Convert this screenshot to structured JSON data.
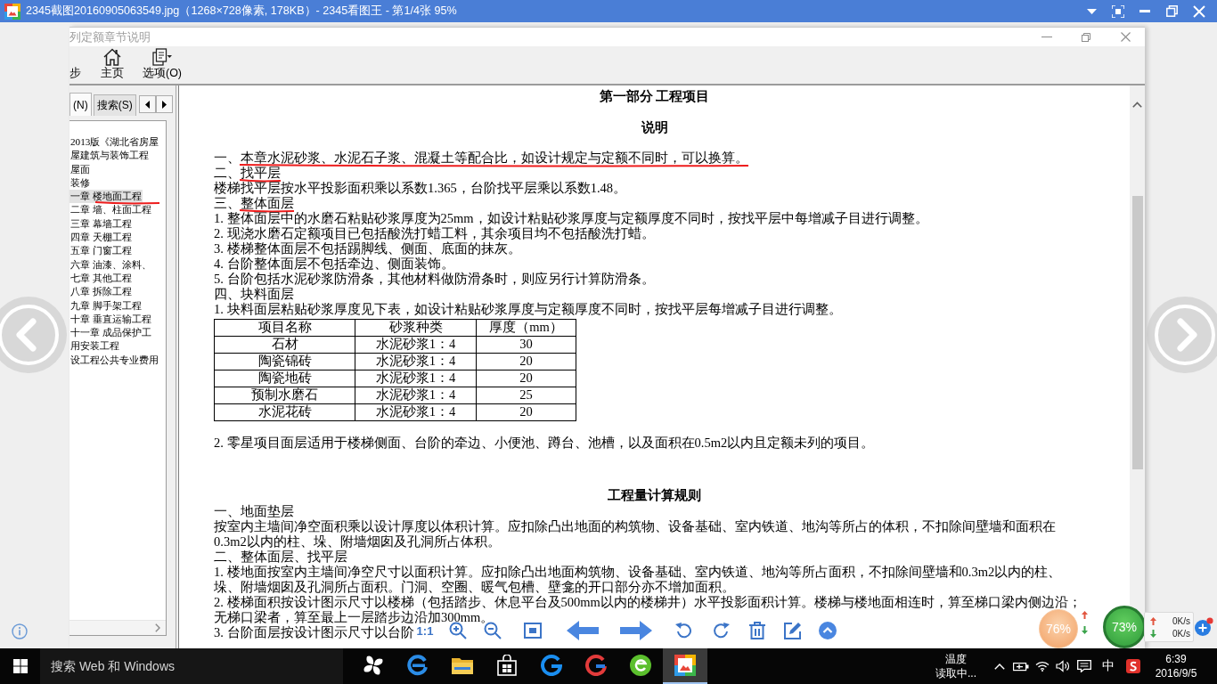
{
  "title_bar": {
    "title": "2345截图20160905063549.jpg（1268×728像素, 178KB）- 2345看图王 - 第1/4张 95%"
  },
  "document_window": {
    "title": "列定额章节说明",
    "toolbar": [
      {
        "kind": "plain",
        "label": "步"
      },
      {
        "kind": "home",
        "label": "主页"
      },
      {
        "kind": "options",
        "label": "选项(O)"
      }
    ]
  },
  "sidebar": {
    "tabs": [
      {
        "label": "(N)",
        "selected": true
      },
      {
        "label": "搜索(S)",
        "selected": false
      }
    ],
    "tree": [
      {
        "label": "2013版《湖北省房屋",
        "selected": false,
        "marked": false
      },
      {
        "label": "屋建筑与装饰工程",
        "selected": false,
        "marked": false
      },
      {
        "label": "屋面",
        "selected": false,
        "marked": false
      },
      {
        "label": "装修",
        "selected": false,
        "marked": false
      },
      {
        "label": "一章 楼地面工程",
        "selected": true,
        "marked": true
      },
      {
        "label": "二章 墙、柱面工程",
        "selected": false,
        "marked": false
      },
      {
        "label": "三章 幕墙工程",
        "selected": false,
        "marked": false
      },
      {
        "label": "四章 天棚工程",
        "selected": false,
        "marked": false
      },
      {
        "label": "五章 门窗工程",
        "selected": false,
        "marked": false
      },
      {
        "label": "六章 油漆、涂料、",
        "selected": false,
        "marked": false
      },
      {
        "label": "七章 其他工程",
        "selected": false,
        "marked": false
      },
      {
        "label": "八章 拆除工程",
        "selected": false,
        "marked": false
      },
      {
        "label": "九章 脚手架工程",
        "selected": false,
        "marked": false
      },
      {
        "label": "十章 垂直运输工程",
        "selected": false,
        "marked": false
      },
      {
        "label": "十一章 成品保护工",
        "selected": false,
        "marked": false
      },
      {
        "label": "用安装工程",
        "selected": false,
        "marked": false
      },
      {
        "label": "设工程公共专业费用",
        "selected": false,
        "marked": false
      }
    ]
  },
  "content": {
    "part_title": "第一部分 工程项目",
    "sections": [
      {
        "title": "说明",
        "blocks": [
          {
            "kind": "line",
            "text": "一、本章水泥砂浆、水泥石子浆、混凝土等配合比，如设计规定与定额不同时，可以换算。",
            "marked": true
          },
          {
            "kind": "line",
            "text": "二、找平层",
            "marked": true
          },
          {
            "kind": "line",
            "text": "楼梯找平层按水平投影面积乘以系数1.365，台阶找平层乘以系数1.48。",
            "marked": false
          },
          {
            "kind": "line",
            "text": "三、整体面层",
            "marked": true
          },
          {
            "kind": "line",
            "text": "1. 整体面层中的水磨石粘贴砂浆厚度为25mm，如设计粘贴砂浆厚度与定额厚度不同时，按找平层中每增减子目进行调整。",
            "marked": false
          },
          {
            "kind": "line",
            "text": "2. 现浇水磨石定额项目已包括酸洗打蜡工料，其余项目均不包括酸洗打蜡。",
            "marked": false
          },
          {
            "kind": "line",
            "text": "3. 楼梯整体面层不包括踢脚线、侧面、底面的抹灰。",
            "marked": false
          },
          {
            "kind": "line",
            "text": "4. 台阶整体面层不包括牵边、侧面装饰。",
            "marked": false
          },
          {
            "kind": "line",
            "text": "5. 台阶包括水泥砂浆防滑条，其他材料做防滑条时，则应另行计算防滑条。",
            "marked": false
          },
          {
            "kind": "line",
            "text": "四、块料面层",
            "marked": false
          },
          {
            "kind": "line",
            "text": "1. 块料面层粘贴砂浆厚度见下表，如设计粘贴砂浆厚度与定额厚度不同时，按找平层每增减子目进行调整。",
            "marked": false
          },
          {
            "kind": "table",
            "columns": [
              "项目名称",
              "砂浆种类",
              "厚度（mm）"
            ],
            "rows": [
              [
                "石材",
                "水泥砂浆1：4",
                "30"
              ],
              [
                "陶瓷锦砖",
                "水泥砂浆1：4",
                "20"
              ],
              [
                "陶瓷地砖",
                "水泥砂浆1：4",
                "20"
              ],
              [
                "预制水磨石",
                "水泥砂浆1：4",
                "25"
              ],
              [
                "水泥花砖",
                "水泥砂浆1：4",
                "20"
              ]
            ]
          },
          {
            "kind": "line",
            "text": "2. 零星项目面层适用于楼梯侧面、台阶的牵边、小便池、蹲台、池槽，以及面积在0.5m2以内且定额未列的项目。",
            "marked": false
          }
        ]
      },
      {
        "title": "工程量计算规则",
        "blocks": [
          {
            "kind": "line",
            "text": "一、地面垫层",
            "marked": false
          },
          {
            "kind": "line",
            "text": "按室内主墙间净空面积乘以设计厚度以体积计算。应扣除凸出地面的构筑物、设备基础、室内铁道、地沟等所占的体积，不扣除间壁墙和面积在",
            "marked": false
          },
          {
            "kind": "line",
            "text": "0.3m2以内的柱、垛、附墙烟囱及孔洞所占体积。",
            "marked": false
          },
          {
            "kind": "line",
            "text": "二、整体面层、找平层",
            "marked": false
          },
          {
            "kind": "line",
            "text": "1. 楼地面按室内主墙间净空尺寸以面积计算。应扣除凸出地面构筑物、设备基础、室内铁道、地沟等所占面积，不扣除间壁墙和0.3m2以内的柱、",
            "marked": false
          },
          {
            "kind": "line",
            "text": "垛、附墙烟囱及孔洞所占面积。门洞、空圈、暖气包槽、壁龛的开口部分亦不增加面积。",
            "marked": false
          },
          {
            "kind": "line",
            "text": "2. 楼梯面积按设计图示尺寸以楼梯（包括踏步、休息平台及500mm以内的楼梯井）水平投影面积计算。楼梯与楼地面相连时，算至梯口梁内侧边沿；",
            "marked": false
          },
          {
            "kind": "line",
            "text": "无梯口梁者，算至最上一层踏步边沿加300mm。",
            "marked": false
          },
          {
            "kind": "line",
            "text": "3. 台阶面层按设计图示尺寸以台阶",
            "marked": false
          }
        ]
      }
    ]
  },
  "viewer_toolbar": [
    {
      "kind": "actual_size",
      "label": "1:1"
    },
    {
      "kind": "zoom_in"
    },
    {
      "kind": "zoom_out"
    },
    {
      "kind": "fit"
    },
    {
      "kind": "previous"
    },
    {
      "kind": "next"
    },
    {
      "kind": "rotate_left"
    },
    {
      "kind": "rotate_right"
    },
    {
      "kind": "delete"
    },
    {
      "kind": "edit"
    },
    {
      "kind": "collapse"
    }
  ],
  "floating_balls": [
    {
      "kind": "small",
      "reading": "76%"
    },
    {
      "kind": "large",
      "reading": "73%"
    }
  ],
  "network_monitor": {
    "upload": "0K/s",
    "download": "0K/s"
  },
  "taskbar": {
    "search": {
      "placeholder": "搜索 Web 和 Windows"
    },
    "apps": [
      {
        "kind": "pinwheel",
        "selected": false
      },
      {
        "kind": "ring",
        "selected": false
      },
      {
        "kind": "folder",
        "selected": false
      },
      {
        "kind": "bag",
        "selected": false
      },
      {
        "kind": "swirl",
        "selected": false
      },
      {
        "kind": "swirl2",
        "selected": false
      },
      {
        "kind": "globe",
        "selected": false
      },
      {
        "kind": "viewer",
        "selected": true
      }
    ],
    "weather": {
      "label": "温度",
      "status": "读取中..."
    },
    "input_method": "中",
    "clock": {
      "time": "6:39",
      "date": "2016/9/5"
    }
  }
}
